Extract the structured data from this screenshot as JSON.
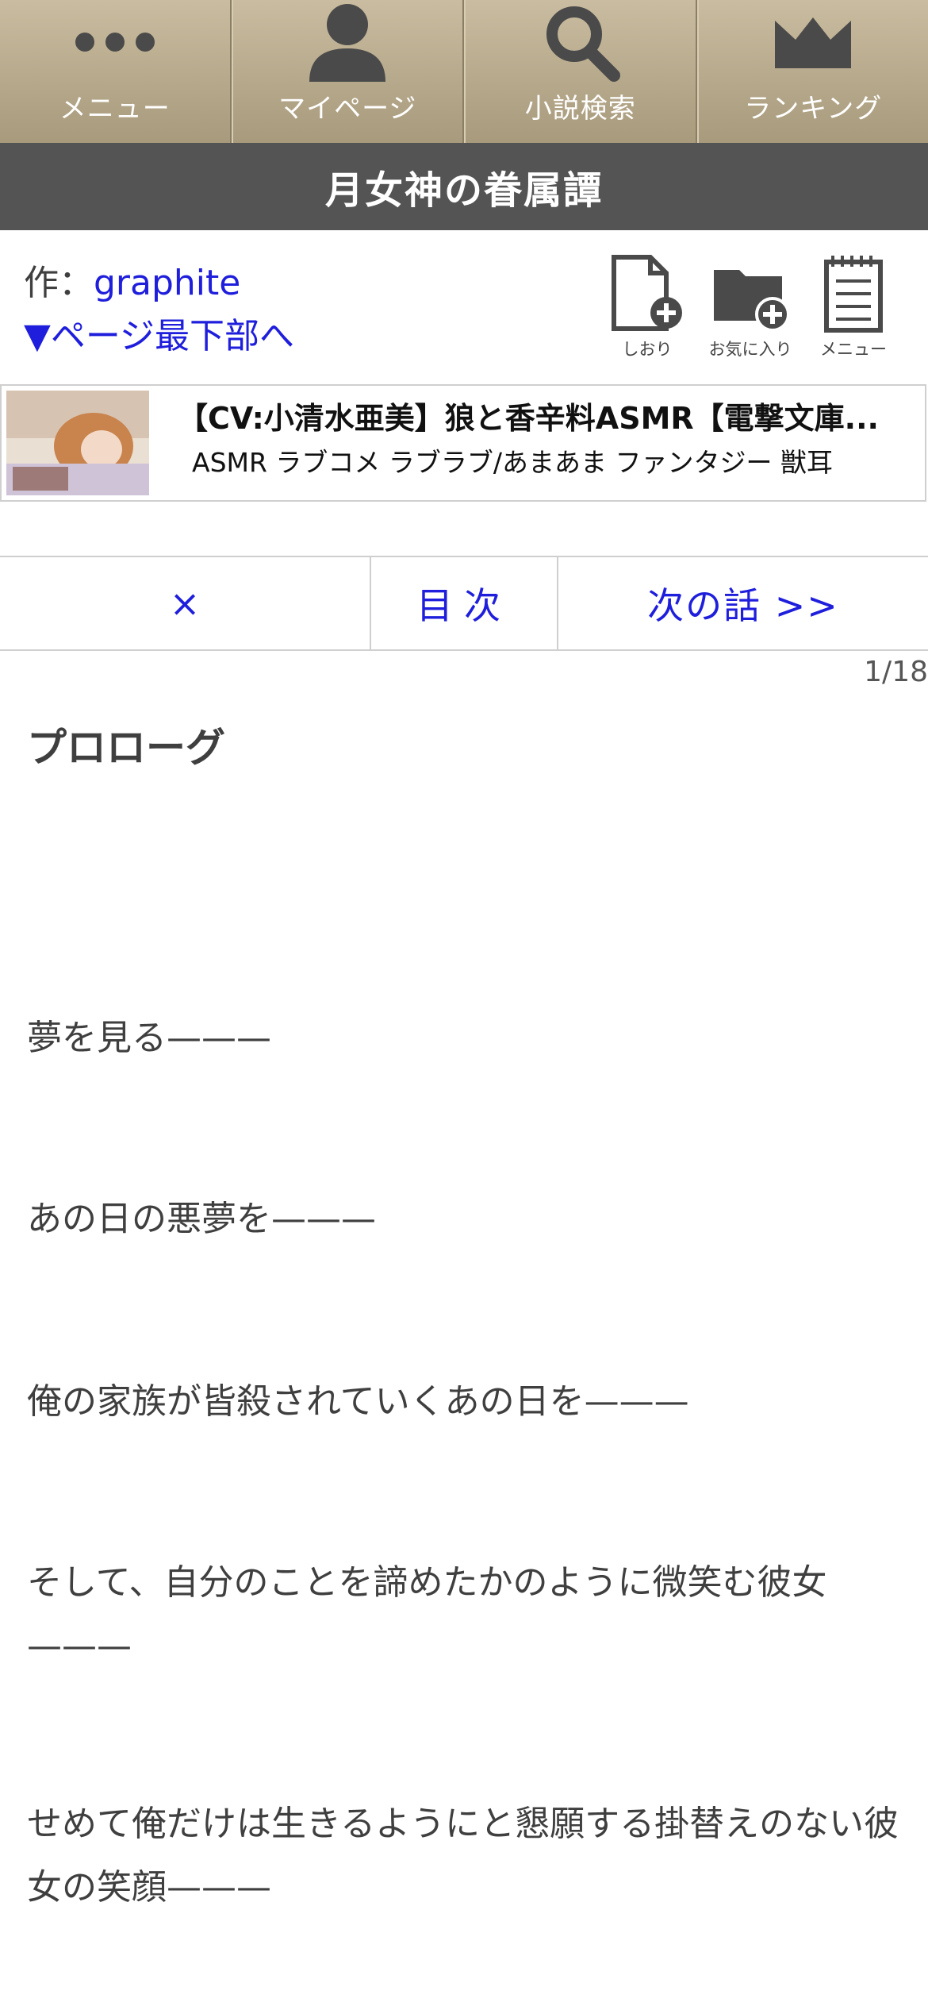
{
  "nav": {
    "items": [
      {
        "label": "メニュー",
        "icon": "dots-menu-icon"
      },
      {
        "label": "マイページ",
        "icon": "user-icon"
      },
      {
        "label": "小説検索",
        "icon": "search-icon"
      },
      {
        "label": "ランキング",
        "icon": "crown-icon"
      }
    ]
  },
  "novel": {
    "title": "月女神の眷属譚",
    "author_prefix": "作：",
    "author": "graphite",
    "jump_bottom": "▼ページ最下部へ"
  },
  "tools": [
    {
      "label": "しおり",
      "icon": "bookmark-add-icon"
    },
    {
      "label": "お気に入り",
      "icon": "folder-add-icon"
    },
    {
      "label": "メニュー",
      "icon": "notepad-icon"
    }
  ],
  "ad": {
    "title": "【CV:小清水亜美】狼と香辛料ASMR【電撃文庫...",
    "tags": "ASMR ラブコメ ラブラブ/あまあま ファンタジー 獣耳"
  },
  "pager": {
    "close": "×",
    "toc": "目次",
    "next": "次の話 >>"
  },
  "page_count": "1/18",
  "chapter_title": "プロローグ",
  "body": [
    "夢を見る———",
    "あの日の悪夢を———",
    "俺の家族が皆殺されていくあの日を———",
    "そして、自分のことを諦めたかのように微笑む彼女———",
    "せめて俺だけは生きるようにと懇願する掛替えのない彼女の笑顔———"
  ],
  "colors": {
    "link": "#1e1edc",
    "titlebar": "#545454",
    "nav": "#b5a889"
  }
}
